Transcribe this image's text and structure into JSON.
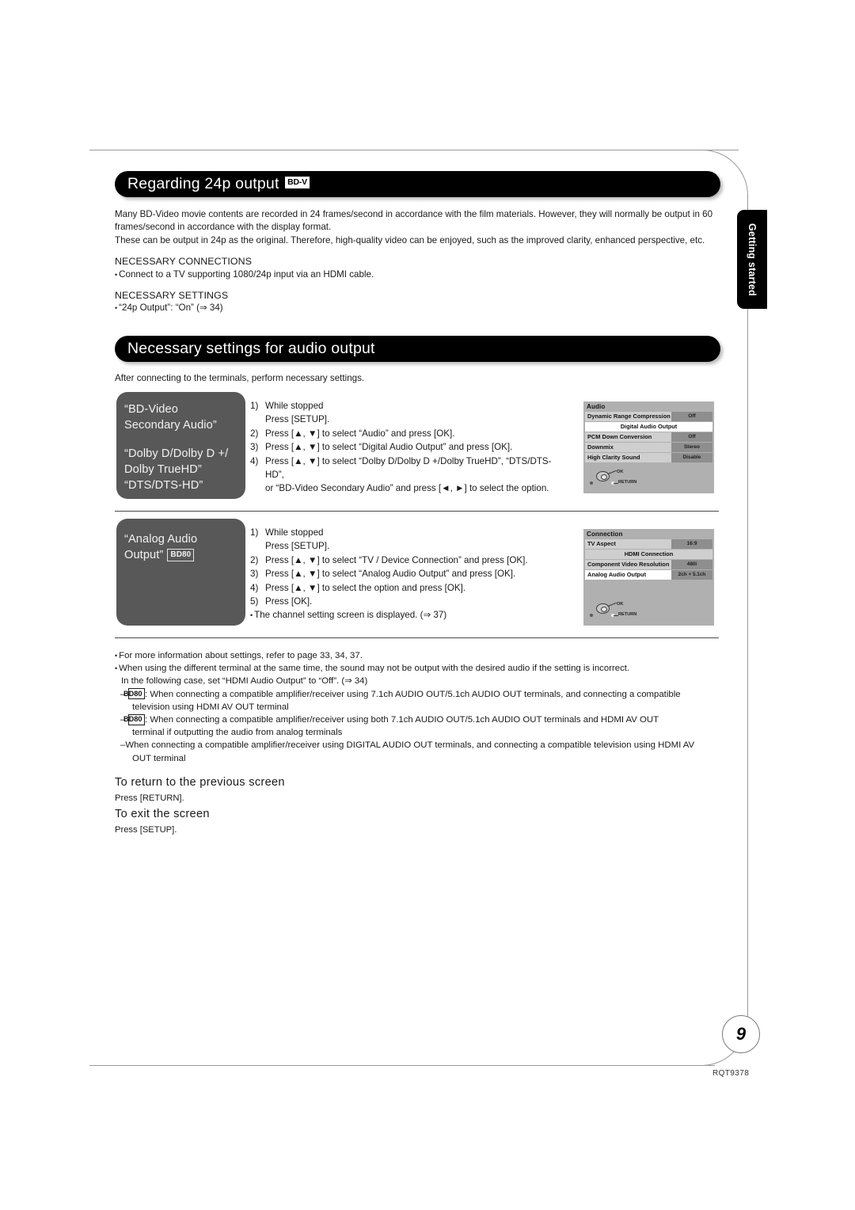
{
  "side_tab": {
    "label": "Getting started"
  },
  "section1": {
    "title": "Regarding 24p output",
    "badge": "BD-V",
    "paragraph1": "Many BD-Video movie contents are recorded in 24 frames/second in accordance with the film materials. However, they will normally be output in 60 frames/second in accordance with the display format.",
    "paragraph2": "These can be output in 24p as the original. Therefore, high-quality video can be enjoyed, such as the improved clarity, enhanced perspective, etc.",
    "sub1_title": "NECESSARY CONNECTIONS",
    "sub1_bullet": "Connect to a TV supporting 1080/24p input via an HDMI cable.",
    "sub2_title": "NECESSARY SETTINGS",
    "sub2_bullet": "“24p Output”: “On” (⇒ 34)"
  },
  "section2": {
    "title": "Necessary settings for audio output",
    "intro": "After connecting to the terminals, perform necessary settings."
  },
  "block1": {
    "label_line1": "“BD-Video",
    "label_line2": "Secondary Audio”",
    "label_line3": "“Dolby D/Dolby D +/",
    "label_line4": "Dolby TrueHD”",
    "label_line5": "“DTS/DTS-HD”",
    "steps": [
      {
        "num": "1)",
        "text": "While stopped",
        "sub": "Press [SETUP]."
      },
      {
        "num": "2)",
        "text": "Press [▲, ▼] to select “Audio” and press [OK]."
      },
      {
        "num": "3)",
        "text": "Press [▲, ▼] to select “Digital Audio Output” and press [OK]."
      },
      {
        "num": "4)",
        "text": "Press [▲, ▼] to select “Dolby D/Dolby D +/Dolby TrueHD”, “DTS/DTS-HD”,",
        "sub": "or “BD-Video Secondary Audio” and press [◄, ►] to select the option."
      }
    ],
    "screen": {
      "title": "Audio",
      "rows": [
        {
          "type": "pair",
          "label": "Dynamic Range Compression",
          "value": "Off",
          "selected": false
        },
        {
          "type": "full",
          "label": "Digital Audio Output",
          "selected": true
        },
        {
          "type": "pair",
          "label": "PCM Down Conversion",
          "value": "Off",
          "selected": false
        },
        {
          "type": "pair",
          "label": "Downmix",
          "value": "Stereo",
          "selected": false
        },
        {
          "type": "pair",
          "label": "High Clarity Sound",
          "value": "Disable",
          "selected": false
        }
      ],
      "ok_label": "OK",
      "return_label": "RETURN"
    }
  },
  "block2": {
    "label_line1": "“Analog Audio",
    "label_line2": "Output”",
    "label_badge": "BD80",
    "steps": [
      {
        "num": "1)",
        "text": "While stopped",
        "sub": "Press [SETUP]."
      },
      {
        "num": "2)",
        "text": "Press [▲, ▼] to select “TV / Device Connection” and press [OK]."
      },
      {
        "num": "3)",
        "text": "Press [▲, ▼] to select “Analog Audio Output” and press [OK]."
      },
      {
        "num": "4)",
        "text": "Press [▲, ▼] to select the option and press [OK]."
      },
      {
        "num": "5)",
        "text": "Press [OK]."
      }
    ],
    "note": "The channel setting screen is displayed. (⇒ 37)",
    "screen": {
      "title": "Connection",
      "rows": [
        {
          "type": "pair",
          "label": "TV Aspect",
          "value": "16:9",
          "selected": false
        },
        {
          "type": "full",
          "label": "HDMI Connection",
          "selected": false
        },
        {
          "type": "pair",
          "label": "Component Video Resolution",
          "value": "480i",
          "selected": false
        },
        {
          "type": "pair",
          "label": "Analog Audio Output",
          "value": "2ch + 5.1ch",
          "selected": true
        }
      ],
      "ok_label": "OK",
      "return_label": "RETURN"
    }
  },
  "notes": {
    "b1": "For more information about settings, refer to page 33, 34, 37.",
    "b2_line1": "When using the different terminal at the same time, the sound may not be output with the desired audio if the setting is incorrect.",
    "b2_line2": "In the following case, set “HDMI Audio Output” to “Off”. (⇒ 34)",
    "d1_badge": "BD80",
    "d1_line1": ": When connecting a compatible amplifier/receiver using 7.1ch AUDIO OUT/5.1ch AUDIO OUT terminals, and connecting a compatible",
    "d1_line2": "television using HDMI AV OUT terminal",
    "d2_badge": "BD80",
    "d2_line1": ": When connecting a compatible amplifier/receiver using both 7.1ch AUDIO OUT/5.1ch AUDIO OUT terminals and HDMI AV OUT",
    "d2_line2": "terminal if outputting the audio from analog terminals",
    "d3_line1": "When connecting a compatible amplifier/receiver using DIGITAL AUDIO OUT terminals, and connecting a compatible television using HDMI AV",
    "d3_line2": "OUT terminal"
  },
  "closing": {
    "head1": "To return to the previous screen",
    "sub1": "Press [RETURN].",
    "head2": "To exit the screen",
    "sub2": "Press [SETUP]."
  },
  "footer": {
    "page_number": "9",
    "doc_id": "RQT9378"
  }
}
